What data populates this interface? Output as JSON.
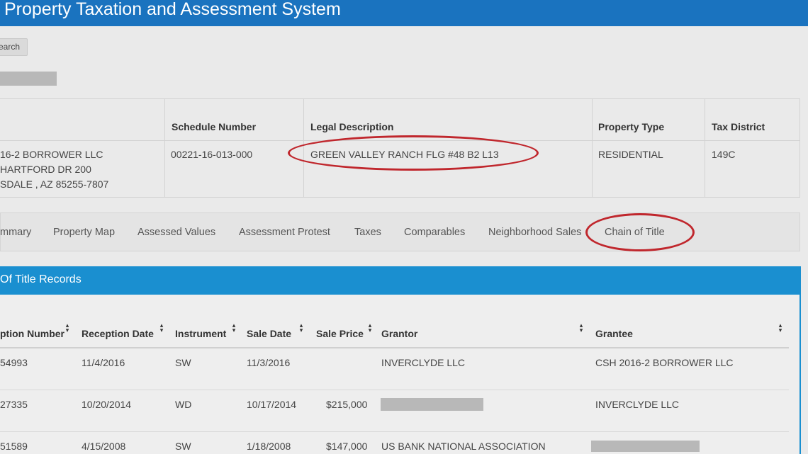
{
  "header": {
    "title": "Property Taxation and Assessment System"
  },
  "search_button": {
    "label": "earch"
  },
  "owner_table": {
    "headers": [
      "Schedule Number",
      "Legal Description",
      "Property Type",
      "Tax District"
    ],
    "owner_address": [
      "16-2 BORROWER LLC",
      "HARTFORD DR 200",
      "SDALE , AZ 85255-7807"
    ],
    "schedule_number": "00221-16-013-000",
    "legal_description": "GREEN VALLEY RANCH FLG #48 B2 L13",
    "property_type": "RESIDENTIAL",
    "tax_district": "149C"
  },
  "tabs": [
    {
      "label": "mmary"
    },
    {
      "label": "Property Map"
    },
    {
      "label": "Assessed Values"
    },
    {
      "label": "Assessment Protest"
    },
    {
      "label": "Taxes"
    },
    {
      "label": "Comparables"
    },
    {
      "label": "Neighborhood Sales"
    },
    {
      "label": "Chain of Title"
    }
  ],
  "chain": {
    "title": "Of Title Records",
    "columns": [
      "ption Number",
      "Reception Date",
      "Instrument",
      "Sale Date",
      "Sale Price",
      "Grantor",
      "Grantee"
    ],
    "sort_glyph": "▴▾",
    "rows": [
      {
        "reception_number": "54993",
        "reception_date": "11/4/2016",
        "instrument": "SW",
        "sale_date": "11/3/2016",
        "sale_price": "",
        "grantor": "INVERCLYDE LLC",
        "grantee": "CSH 2016-2 BORROWER LLC"
      },
      {
        "reception_number": "27335",
        "reception_date": "10/20/2014",
        "instrument": "WD",
        "sale_date": "10/17/2014",
        "sale_price": "$215,000",
        "grantor": "",
        "grantee": "INVERCLYDE LLC"
      },
      {
        "reception_number": "51589",
        "reception_date": "4/15/2008",
        "instrument": "SW",
        "sale_date": "1/18/2008",
        "sale_price": "$147,000",
        "grantor": "US BANK NATIONAL ASSOCIATION",
        "grantee": ""
      }
    ]
  },
  "colors": {
    "header": "#1a73bf",
    "panel_header": "#1a8fd0",
    "annotation": "#c0272d"
  }
}
